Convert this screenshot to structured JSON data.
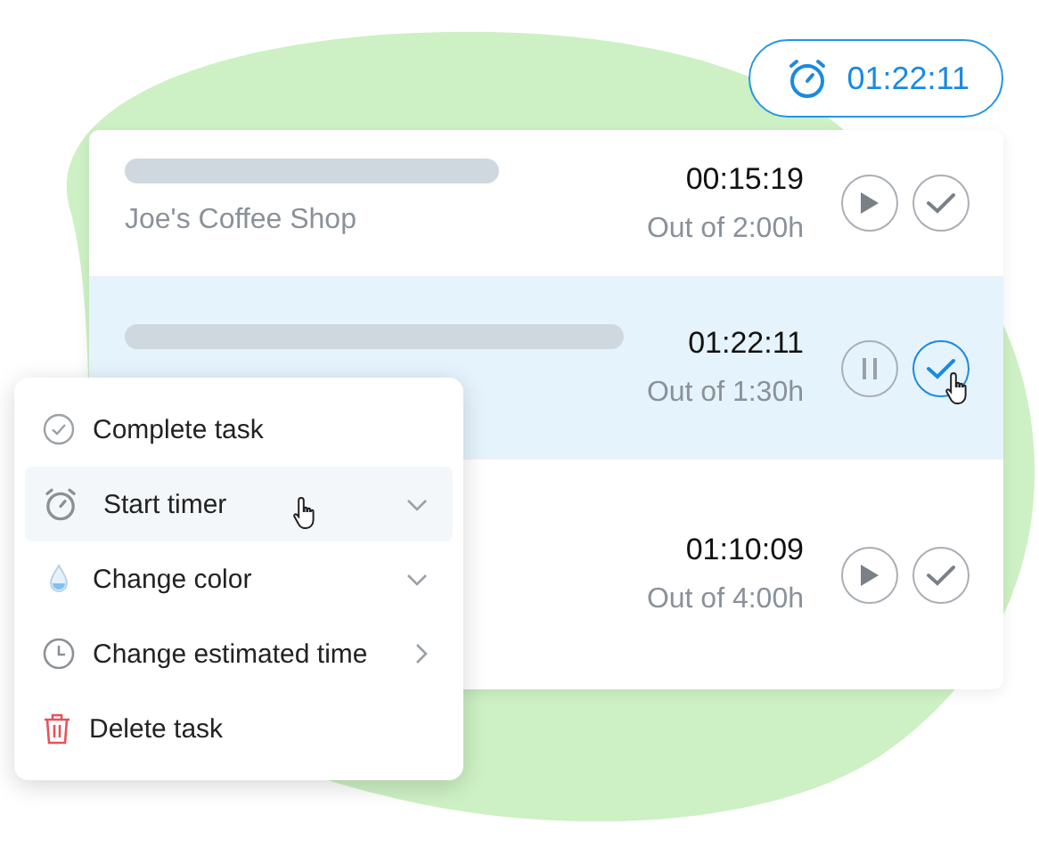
{
  "active_timer": {
    "time": "01:22:11"
  },
  "tasks": [
    {
      "subtitle": "Joe's Coffee Shop",
      "time": "00:15:19",
      "estimate": "Out of 2:00h",
      "selected": false,
      "running": false
    },
    {
      "time": "01:22:11",
      "estimate": "Out of 1:30h",
      "selected": true,
      "running": true
    },
    {
      "time": "01:10:09",
      "estimate": "Out of 4:00h",
      "selected": false,
      "running": false
    }
  ],
  "context_menu": [
    {
      "label": "Complete task",
      "kind": "complete",
      "selected": false
    },
    {
      "label": "Start timer",
      "kind": "timer",
      "selected": true,
      "expandable": true,
      "opens_side": false
    },
    {
      "label": "Change color",
      "kind": "color",
      "selected": false,
      "expandable": true,
      "opens_side": false
    },
    {
      "label": "Change estimated time",
      "kind": "estimate",
      "selected": false,
      "expandable": true,
      "opens_side": true
    },
    {
      "label": "Delete task",
      "kind": "delete",
      "selected": false
    }
  ]
}
